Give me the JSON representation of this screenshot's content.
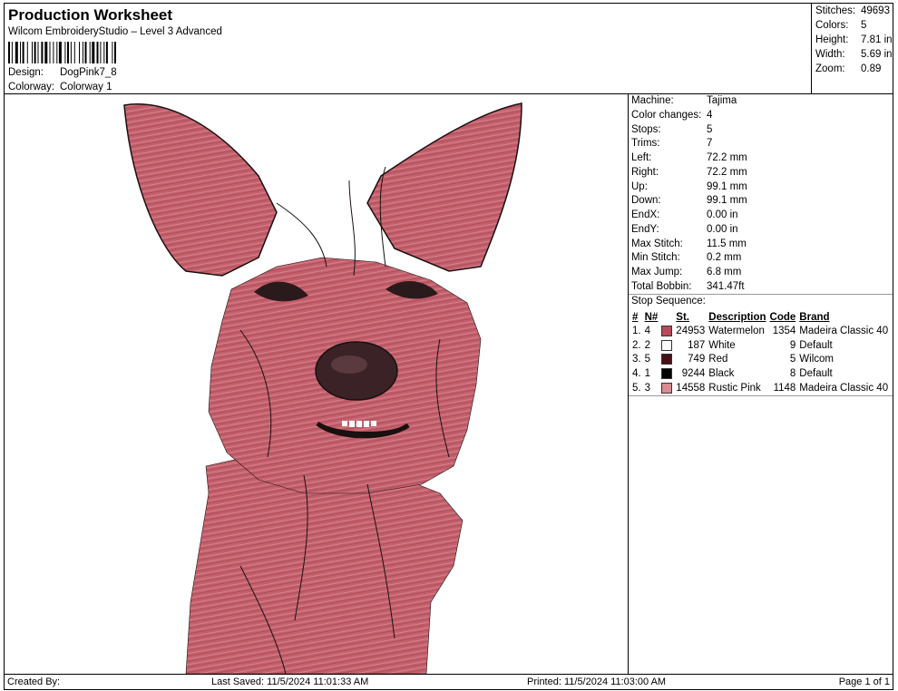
{
  "header": {
    "title": "Production Worksheet",
    "subtitle": "Wilcom EmbroideryStudio – Level 3 Advanced",
    "design_label": "Design:",
    "design_value": "DogPink7_8",
    "colorway_label": "Colorway:",
    "colorway_value": "Colorway 1"
  },
  "stats": [
    {
      "label": "Stitches:",
      "value": "49693"
    },
    {
      "label": "Colors:",
      "value": "5"
    },
    {
      "label": "Height:",
      "value": "7.81 in"
    },
    {
      "label": "Width:",
      "value": "5.69 in"
    },
    {
      "label": "Zoom:",
      "value": "0.89"
    }
  ],
  "details": [
    {
      "label": "Machine:",
      "value": "Tajima"
    },
    {
      "label": "Color changes:",
      "value": "4"
    },
    {
      "label": "Stops:",
      "value": "5"
    },
    {
      "label": "Trims:",
      "value": "7"
    },
    {
      "label": "Left:",
      "value": "72.2 mm"
    },
    {
      "label": "Right:",
      "value": "72.2 mm"
    },
    {
      "label": "Up:",
      "value": "99.1 mm"
    },
    {
      "label": "Down:",
      "value": "99.1 mm"
    },
    {
      "label": "EndX:",
      "value": "0.00 in"
    },
    {
      "label": "EndY:",
      "value": "0.00 in"
    },
    {
      "label": "Max Stitch:",
      "value": "11.5 mm"
    },
    {
      "label": "Min Stitch:",
      "value": "0.2 mm"
    },
    {
      "label": "Max Jump:",
      "value": "6.8 mm"
    },
    {
      "label": "Total Bobbin:",
      "value": "341.47ft"
    }
  ],
  "stop_sequence": {
    "title": "Stop Sequence:",
    "headers": [
      "#",
      "N#",
      "St.",
      "Description",
      "Code",
      "Brand"
    ],
    "rows": [
      {
        "idx": "1.",
        "n": "4",
        "color": "#b84a5c",
        "st": "24953",
        "desc": "Watermelon",
        "code": "1354",
        "brand": "Madeira Classic 40"
      },
      {
        "idx": "2.",
        "n": "2",
        "color": "#ffffff",
        "st": "187",
        "desc": "White",
        "code": "9",
        "brand": "Default"
      },
      {
        "idx": "3.",
        "n": "5",
        "color": "#4a1014",
        "st": "749",
        "desc": "Red",
        "code": "5",
        "brand": "Wilcom"
      },
      {
        "idx": "4.",
        "n": "1",
        "color": "#000000",
        "st": "9244",
        "desc": "Black",
        "code": "8",
        "brand": "Default"
      },
      {
        "idx": "5.",
        "n": "3",
        "color": "#d98a93",
        "st": "14558",
        "desc": "Rustic Pink",
        "code": "1148",
        "brand": "Madeira Classic 40"
      }
    ]
  },
  "footer": {
    "created_by": "Created By:",
    "last_saved": "Last Saved: 11/5/2024 11:01:33 AM",
    "printed": "Printed: 11/5/2024 11:03:00 AM",
    "page": "Page 1 of 1"
  },
  "design_colors": {
    "fur": "#c4606c",
    "fur_light": "#d98a93",
    "outline": "#1a1010",
    "nose": "#3a2226"
  }
}
